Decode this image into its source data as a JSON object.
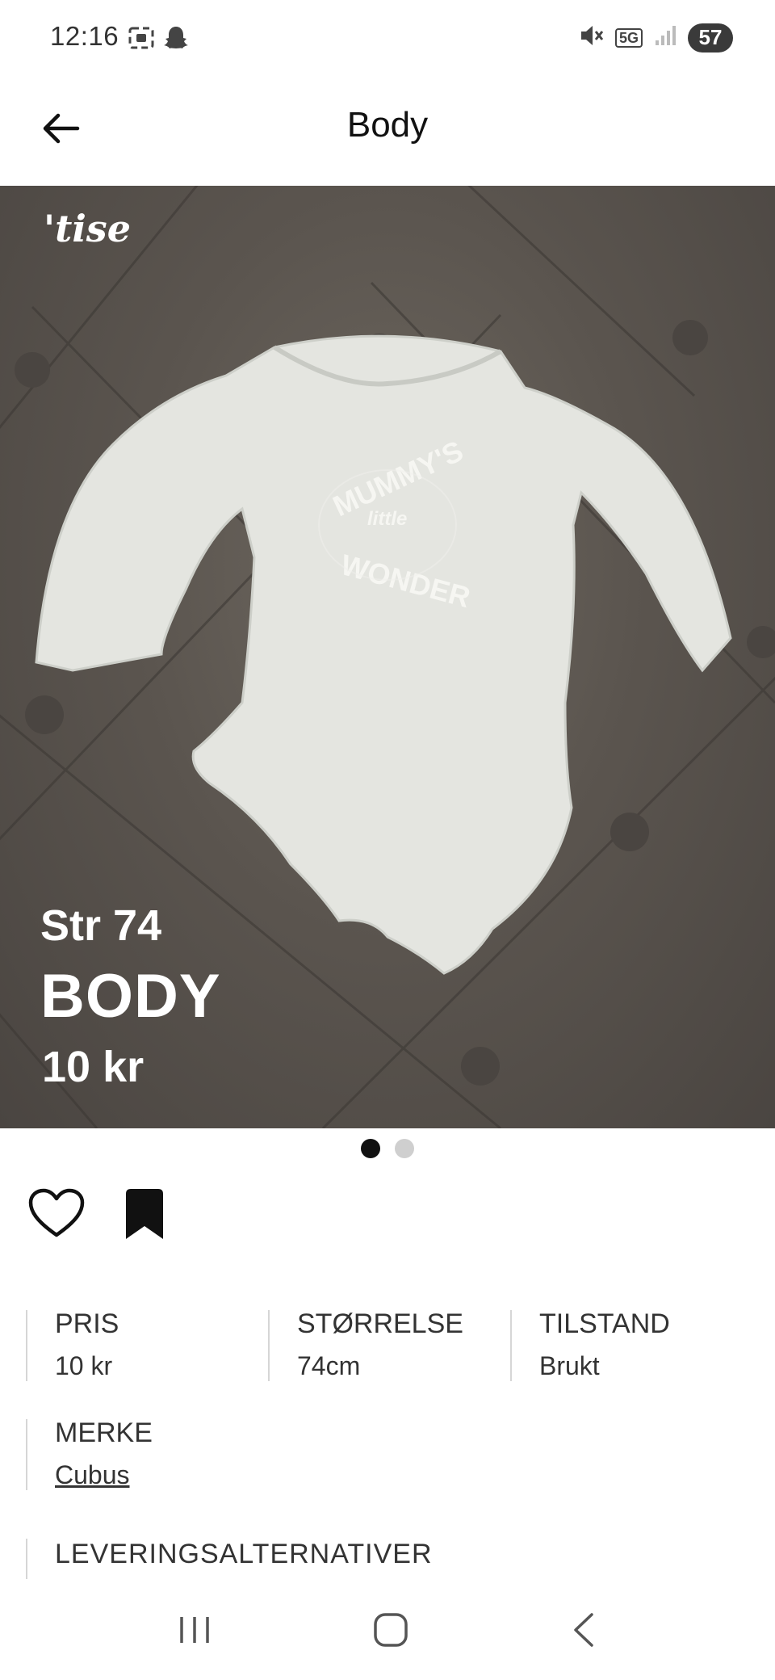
{
  "status_bar": {
    "time": "12:16",
    "network": "5G",
    "battery": "57",
    "icons_left": [
      "screenshot-icon",
      "snapchat-icon"
    ],
    "icons_right": [
      "mute-icon",
      "5g-icon",
      "signal-icon",
      "battery-icon"
    ]
  },
  "appbar": {
    "title": "Body",
    "back_icon": "arrow-left-icon"
  },
  "hero": {
    "logo": "'tise",
    "size_text": "Str 74",
    "title_text": "BODY",
    "price_text": "10 kr",
    "slides": 2,
    "active_slide": 1
  },
  "actions": {
    "like_icon": "heart-icon",
    "save_icon": "bookmark-icon"
  },
  "details": {
    "price_label": "PRIS",
    "price_value": "10 kr",
    "size_label": "STØRRELSE",
    "size_value": "74cm",
    "condition_label": "TILSTAND",
    "condition_value": "Brukt",
    "brand_label": "MERKE",
    "brand_value": "Cubus",
    "delivery_label": "LEVERINGSALTERNATIVER"
  },
  "navbar": {
    "recents_icon": "recents-icon",
    "home_icon": "home-icon",
    "back_icon": "back-icon"
  }
}
